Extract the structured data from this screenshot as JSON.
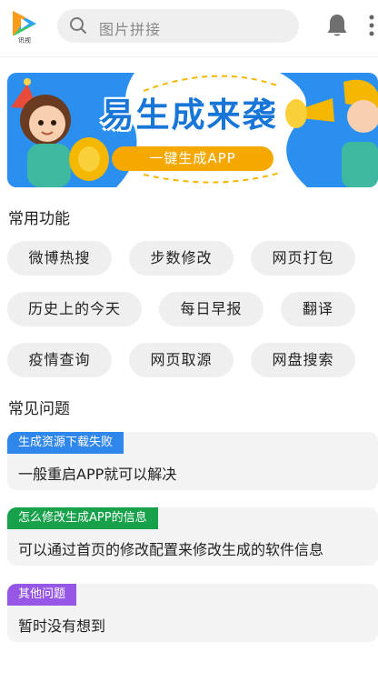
{
  "header": {
    "logo_label": "讯视",
    "search_placeholder": "图片拼接"
  },
  "banner": {
    "title": "易生成来袭",
    "button_label": "一键生成APP"
  },
  "common_features": {
    "title": "常用功能",
    "items": [
      "微博热搜",
      "步数修改",
      "网页打包",
      "历史上的今天",
      "每日早报",
      "翻译",
      "疫情查询",
      "网页取源",
      "网盘搜索"
    ]
  },
  "faq": {
    "title": "常见问题",
    "items": [
      {
        "question": "生成资源下载失败",
        "answer": "一般重启APP就可以解决",
        "color": "#2f86eb"
      },
      {
        "question": "怎么修改生成APP的信息",
        "answer": "可以通过首页的修改配置来修改生成的软件信息",
        "color": "#17a14a"
      },
      {
        "question": "其他问题",
        "answer": "暂时没有想到",
        "color": "#9657e6"
      }
    ]
  },
  "colors": {
    "accent_blue": "#1776d8",
    "accent_yellow": "#f5a800",
    "chip_bg": "#efefef"
  }
}
